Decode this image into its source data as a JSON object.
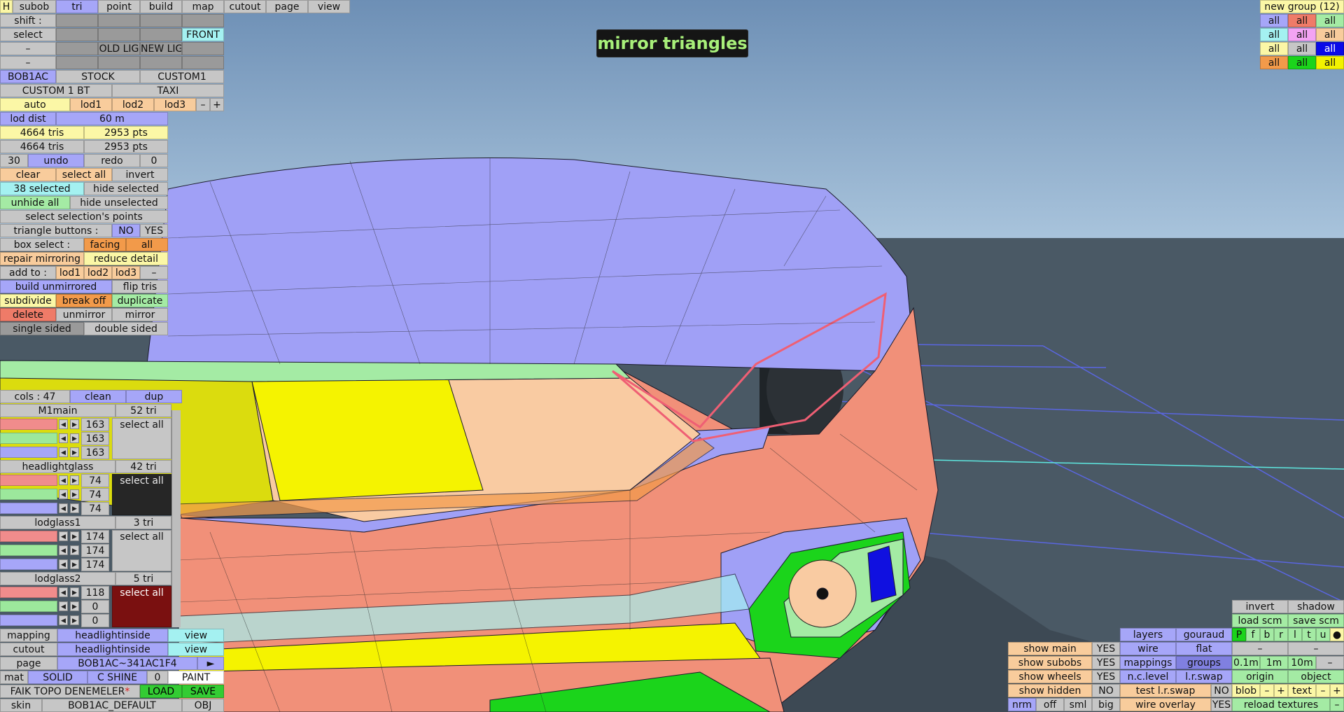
{
  "toolbar": {
    "h": "H",
    "tabs": [
      "subob",
      "tri",
      "point",
      "build",
      "map",
      "cutout",
      "page",
      "view"
    ],
    "active": "tri"
  },
  "left": {
    "shift": "shift :",
    "select": "select",
    "front": "FRONT",
    "dash1": "–",
    "dash2": "–",
    "old_lig": "OLD LIG",
    "new_lig": "NEW LIG",
    "cars": [
      "BOB1AC",
      "STOCK",
      "CUSTOM1"
    ],
    "custom1bt": "CUSTOM 1 BT",
    "taxi": "TAXI",
    "lods": [
      "auto",
      "lod1",
      "lod2",
      "lod3",
      "–",
      "+"
    ],
    "lod_dist_label": "lod dist",
    "lod_dist_value": "60 m",
    "tris1": "4664 tris",
    "pts1": "2953 pts",
    "tris2": "4664 tris",
    "pts2": "2953 pts",
    "undo_count": "30",
    "undo": "undo",
    "redo": "redo",
    "redo_count": "0",
    "clear": "clear",
    "select_all": "select all",
    "invert": "invert",
    "selected": "38 selected",
    "hide_selected": "hide selected",
    "unhide_all": "unhide all",
    "hide_unselected": "hide unselected",
    "select_points": "select selection's points",
    "tri_buttons": "triangle buttons :",
    "no": "NO",
    "yes": "YES",
    "box_select": "box select :",
    "facing": "facing",
    "all": "all",
    "repair_mirroring": "repair mirroring",
    "reduce_detail": "reduce detail",
    "add_to": "add to :",
    "add_lods": [
      "lod1",
      "lod2",
      "lod3",
      "–"
    ],
    "build_unmirrored": "build unmirrored",
    "flip_tris": "flip tris",
    "subdivide": "subdivide",
    "break_off": "break off",
    "duplicate": "duplicate",
    "delete": "delete",
    "unmirror": "unmirror",
    "mirror": "mirror",
    "single_sided": "single sided",
    "double_sided": "double sided"
  },
  "colors_panel": {
    "cols": "cols : 47",
    "clean": "clean",
    "dup": "dup",
    "materials": [
      {
        "name": "M1main",
        "tri": "52 tri",
        "values": [
          "163",
          "163",
          "163"
        ],
        "select": "select all",
        "dark": false
      },
      {
        "name": "headlightglass",
        "tri": "42 tri",
        "values": [
          "74",
          "74",
          "74"
        ],
        "select": "select all",
        "dark": true
      },
      {
        "name": "lodglass1",
        "tri": "3 tri",
        "values": [
          "174",
          "174",
          "174"
        ],
        "select": "select all",
        "dark": false
      },
      {
        "name": "lodglass2",
        "tri": "5 tri",
        "values": [
          "118",
          "0",
          "0"
        ],
        "select": "select all",
        "dark": true
      }
    ]
  },
  "bottom_left": {
    "mapping_label": "mapping",
    "mapping_value": "headlightinside",
    "mapping_view": "view",
    "cutout_label": "cutout",
    "cutout_value": "headlightinside",
    "cutout_view": "view",
    "page_label": "page",
    "page_value": "BOB1AC~341AC1F4",
    "page_arrow": "►",
    "mat": "mat",
    "solid": "SOLID",
    "cshine": "C SHINE",
    "cshine_val": "0",
    "paint": "PAINT",
    "file": "FAIK TOPO DENEMELER",
    "file_mark": "*",
    "load": "LOAD",
    "save": "SAVE",
    "skin_label": "skin",
    "skin_value": "BOB1AC_DEFAULT",
    "obj": "OBJ"
  },
  "hint": "mirror triangles",
  "groups": {
    "title": "new group (12)",
    "rows": [
      [
        "all",
        "all",
        "all"
      ],
      [
        "all",
        "all",
        "all"
      ],
      [
        "all",
        "all",
        "all"
      ],
      [
        "all",
        "all",
        "all"
      ]
    ]
  },
  "bottom_right": {
    "show_main": "show main",
    "show_subobs": "show subobs",
    "show_wheels": "show wheels",
    "show_hidden": "show hidden",
    "yes": "YES",
    "no": "NO",
    "nrm": "nrm",
    "off": "off",
    "sml": "sml",
    "big": "big",
    "layers": "layers",
    "gouraud": "gouraud",
    "wire": "wire",
    "flat": "flat",
    "mappings": "mappings",
    "groups": "groups",
    "nclevel": "n.c.level",
    "lrswap": "l.r.swap",
    "test_lrswap": "test l.r.swap",
    "wire_overlay": "wire overlay",
    "invert": "invert",
    "shadow": "shadow",
    "load_scm": "load scm",
    "save_scm": "save scm",
    "pflags": [
      "P",
      "f",
      "b",
      "r",
      "l",
      "t",
      "u",
      "●"
    ],
    "dashes": [
      "–",
      "–"
    ],
    "distances": [
      "0.1m",
      "1m",
      "10m",
      "–"
    ],
    "origin": "origin",
    "object": "object",
    "blob": "blob",
    "minus": "–",
    "plus": "+",
    "text": "text",
    "reload": "reload textures"
  },
  "colors": {
    "sky_top": "#6d8fb5",
    "sky_bottom": "#a9c4dc",
    "ground": "#4a5965",
    "body_blue": "#a0a0f6",
    "body_red": "#f19079",
    "grill_yellow": "#f5f300",
    "grill_peach": "#f9cba2",
    "accent_green": "#1bd41b",
    "hint_bg": "#151515",
    "hint_fg": "#a8f07a"
  }
}
